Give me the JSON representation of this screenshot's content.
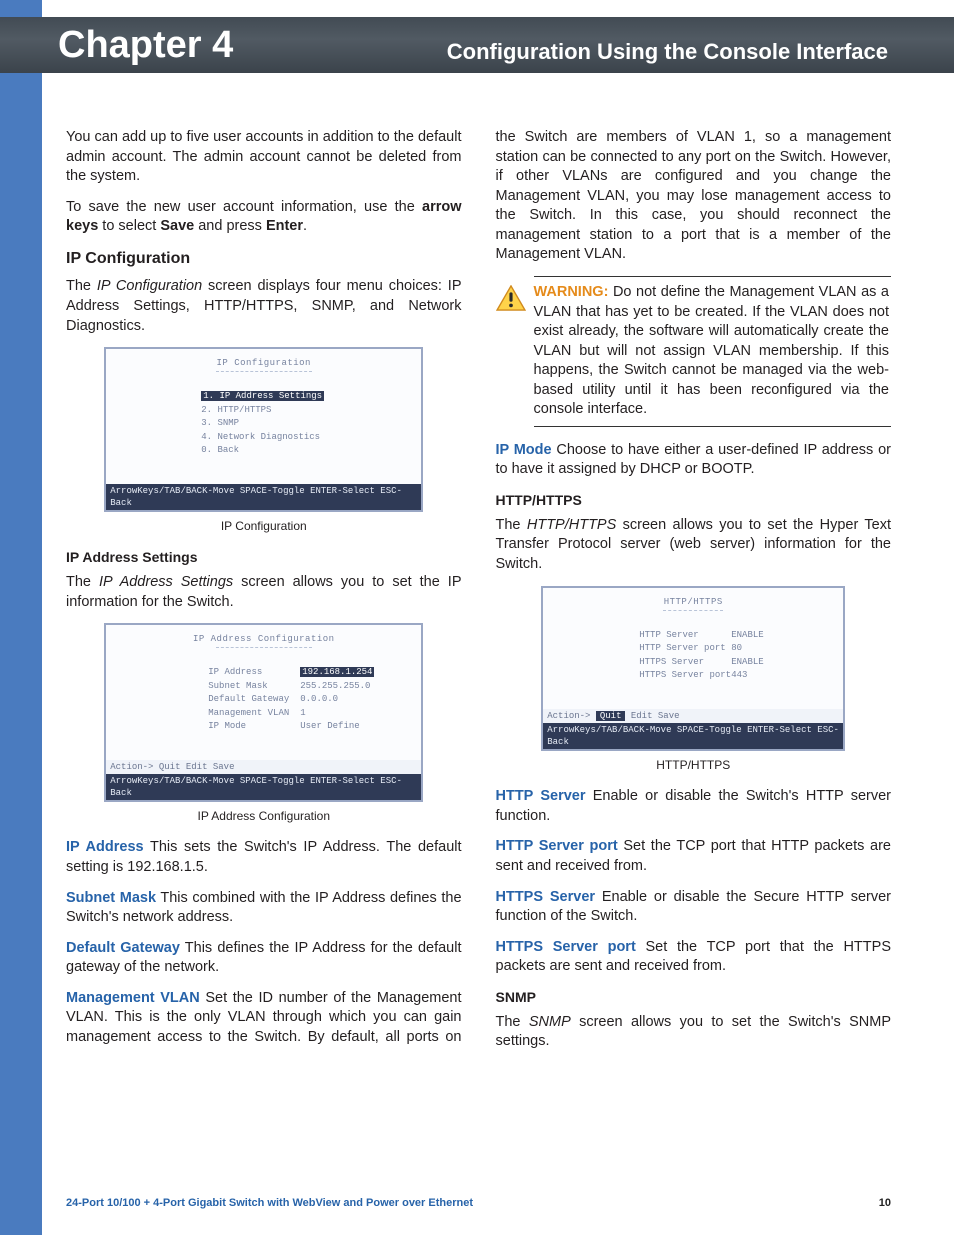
{
  "header": {
    "chapter": "Chapter 4",
    "title": "Configuration Using the Console Interface"
  },
  "left": {
    "intro1": "You can add up to five user accounts in addition to the default admin account. The admin account cannot be deleted from the system.",
    "intro2_a": "To save the new user account information, use the ",
    "intro2_b": "arrow keys",
    "intro2_c": " to select ",
    "intro2_d": "Save",
    "intro2_e": " and press ",
    "intro2_f": "Enter",
    "intro2_g": ".",
    "ip_config_h": "IP Configuration",
    "ip_config_p_a": "The ",
    "ip_config_p_b": "IP Configuration",
    "ip_config_p_c": " screen displays four menu choices: IP Address Settings, HTTP/HTTPS, SNMP, and Network Diagnostics.",
    "fig1": {
      "title": "IP Configuration",
      "items": [
        "1. IP Address Settings",
        "2. HTTP/HTTPS",
        "3. SNMP",
        "4. Network Diagnostics",
        "0. Back"
      ],
      "foot": "ArrowKeys/TAB/BACK-Move  SPACE-Toggle  ENTER-Select  ESC-Back",
      "caption": "IP Configuration"
    },
    "ip_addr_h": "IP Address Settings",
    "ip_addr_p_a": "The ",
    "ip_addr_p_b": "IP Address Settings",
    "ip_addr_p_c": " screen allows you to set the IP information for the Switch.",
    "fig2": {
      "title": "IP Address Configuration",
      "rows": [
        {
          "k": "IP Address",
          "v": "192.168.1.254",
          "sel": true
        },
        {
          "k": "Subnet Mask",
          "v": "255.255.255.0"
        },
        {
          "k": "Default Gateway",
          "v": "0.0.0.0"
        },
        {
          "k": "Management VLAN",
          "v": "1"
        },
        {
          "k": "IP Mode",
          "v": "User Define"
        }
      ],
      "actions_pre": "Action->",
      "actions": "Quit  Edit  Save",
      "tag": "",
      "foot": "ArrowKeys/TAB/BACK-Move  SPACE-Toggle  ENTER-Select  ESC-Back",
      "caption": "IP Address Configuration"
    },
    "defs": {
      "ipaddr_t": "IP Address",
      "ipaddr_b": "  This sets the Switch's IP Address. The default setting is 192.168.1.5.",
      "subnet_t": "Subnet Mask",
      "subnet_b": "  This combined with the IP Address defines the Switch's network address.",
      "gw_t": "Default Gateway",
      "gw_b": " This defines the IP Address for the default gateway of the network."
    }
  },
  "right": {
    "mvlan_t": "Management VLAN",
    "mvlan_b": " Set the ID number of the Management VLAN. This is the only VLAN through which you can gain management access to the Switch. By default, all ports on the Switch are members of VLAN 1, so a management station can be connected to any port on the Switch. However, if other VLANs are configured and you change the Management VLAN, you may lose management access to the Switch. In this case, you should reconnect the management station to a port that is a member of the Management VLAN.",
    "warn_label": "WARNING:",
    "warn_body": " Do not define the Management VLAN as a VLAN that has yet to be created. If the VLAN does not exist already, the software will automatically create the VLAN but will not assign VLAN membership. If this happens, the Switch cannot be managed via the web-based utility until it has been reconfigured via the console interface.",
    "ipmode_t": "IP Mode",
    "ipmode_b": "  Choose to have either a user-defined IP address or to have it assigned by DHCP or BOOTP.",
    "http_h": "HTTP/HTTPS",
    "http_p_a": "The ",
    "http_p_b": "HTTP/HTTPS",
    "http_p_c": " screen allows you to set the Hyper Text Transfer Protocol server (web server) information for the Switch.",
    "fig3": {
      "title": "HTTP/HTTPS",
      "rows": [
        {
          "k": "HTTP Server",
          "v": "ENABLE"
        },
        {
          "k": "HTTP Server port",
          "v": "80"
        },
        {
          "k": "HTTPS Server",
          "v": "ENABLE"
        },
        {
          "k": "HTTPS Server port",
          "v": "443"
        }
      ],
      "actions_pre": "Action->",
      "actions_sel": "Quit",
      "actions_rest": "  Edit  Save",
      "foot": "ArrowKeys/TAB/BACK-Move  SPACE-Toggle  ENTER-Select  ESC-Back",
      "caption": "HTTP/HTTPS"
    },
    "defs": {
      "httpserver_t": "HTTP Server",
      "httpserver_b": "  Enable or disable the Switch's HTTP server function.",
      "httpport_t": "HTTP Server port",
      "httpport_b": "  Set the TCP port that HTTP packets are sent and received from.",
      "httpsserver_t": "HTTPS Server",
      "httpsserver_b": "  Enable or disable the Secure HTTP server function of the Switch.",
      "httpsport_t": "HTTPS Server port",
      "httpsport_b": " Set the TCP port that the HTTPS packets are sent and received from."
    },
    "snmp_h": "SNMP",
    "snmp_p_a": "The ",
    "snmp_p_b": "SNMP",
    "snmp_p_c": " screen allows you to set the Switch's SNMP settings."
  },
  "footer": {
    "left": "24-Port 10/100 + 4-Port Gigabit Switch with WebView and Power over Ethernet",
    "page": "10"
  }
}
